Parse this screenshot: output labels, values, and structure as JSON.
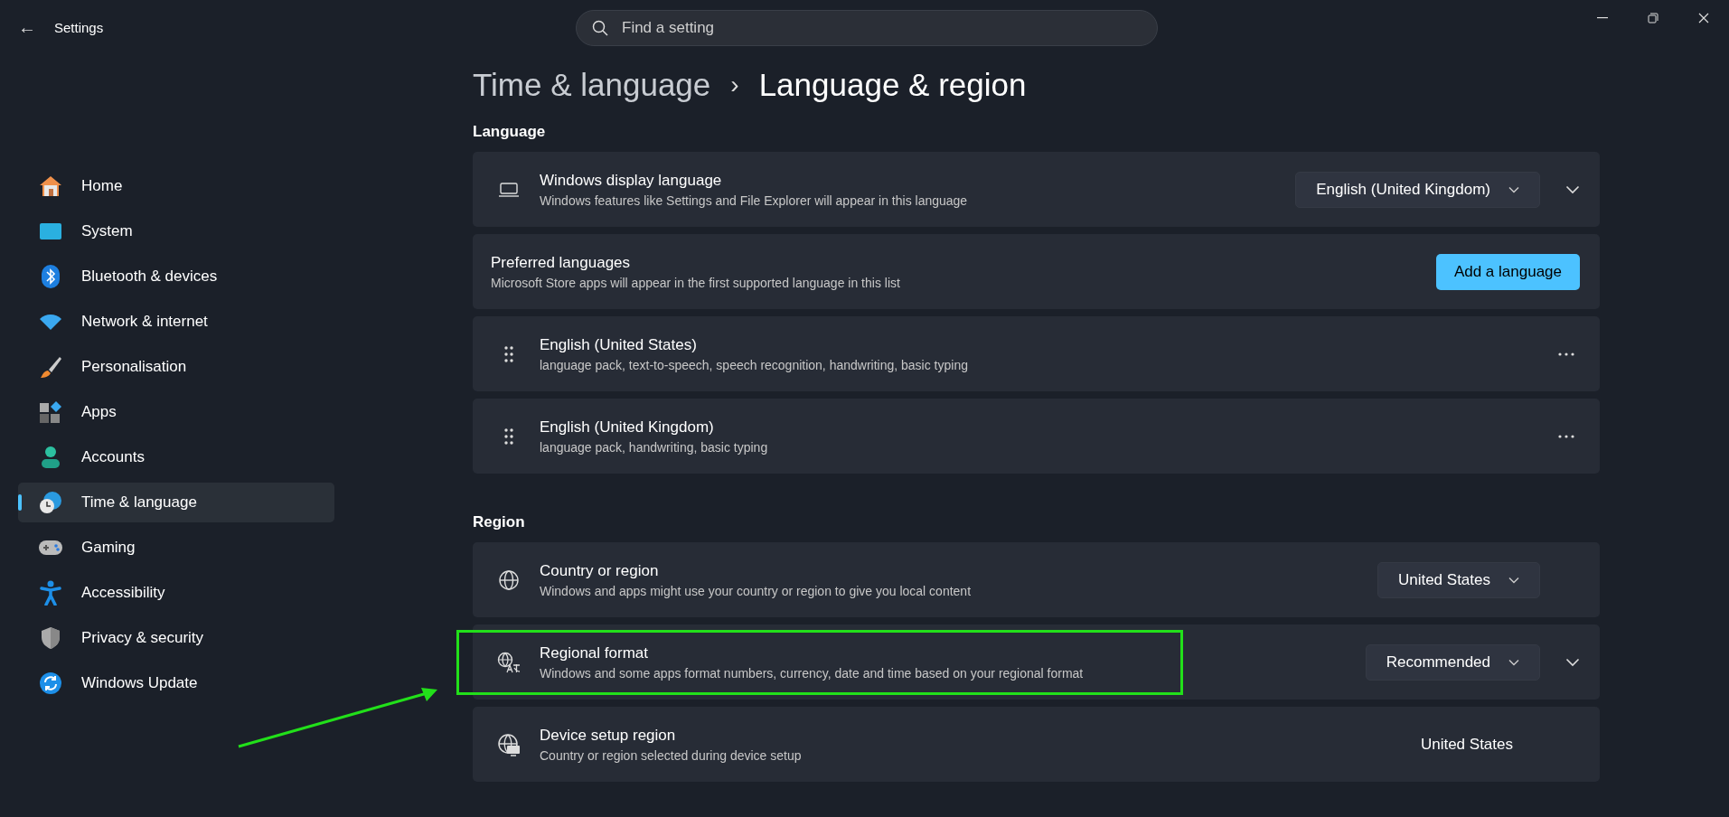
{
  "window": {
    "title": "Settings",
    "back": "←"
  },
  "search": {
    "placeholder": "Find a setting"
  },
  "sidebar": {
    "items": [
      {
        "label": "Home",
        "selected": false
      },
      {
        "label": "System",
        "selected": false
      },
      {
        "label": "Bluetooth & devices",
        "selected": false
      },
      {
        "label": "Network & internet",
        "selected": false
      },
      {
        "label": "Personalisation",
        "selected": false
      },
      {
        "label": "Apps",
        "selected": false
      },
      {
        "label": "Accounts",
        "selected": false
      },
      {
        "label": "Time & language",
        "selected": true
      },
      {
        "label": "Gaming",
        "selected": false
      },
      {
        "label": "Accessibility",
        "selected": false
      },
      {
        "label": "Privacy & security",
        "selected": false
      },
      {
        "label": "Windows Update",
        "selected": false
      }
    ]
  },
  "breadcrumb": {
    "parent": "Time & language",
    "separator": "›",
    "current": "Language & region"
  },
  "sections": [
    {
      "heading": "Language",
      "rows": [
        {
          "kind": "dropdown",
          "title": "Windows display language",
          "description": "Windows features like Settings and File Explorer will appear in this language",
          "value": "English (United Kingdom)",
          "expandable": true,
          "highlighted": false
        },
        {
          "kind": "button",
          "title": "Preferred languages",
          "description": "Microsoft Store apps will appear in the first supported language in this list",
          "button_label": "Add a language",
          "highlighted": false
        },
        {
          "kind": "language",
          "title": "English (United States)",
          "description": "language pack, text-to-speech, speech recognition, handwriting, basic typing",
          "highlighted": false
        },
        {
          "kind": "language",
          "title": "English (United Kingdom)",
          "description": "language pack, handwriting, basic typing",
          "highlighted": false
        }
      ]
    },
    {
      "heading": "Region",
      "rows": [
        {
          "kind": "dropdown",
          "title": "Country or region",
          "description": "Windows and apps might use your country or region to give you local content",
          "value": "United States",
          "expandable": false,
          "highlighted": false
        },
        {
          "kind": "dropdown",
          "title": "Regional format",
          "description": "Windows and some apps format numbers, currency, date and time based on your regional format",
          "value": "Recommended",
          "expandable": true,
          "highlighted": true
        },
        {
          "kind": "value",
          "title": "Device setup region",
          "description": "Country or region selected during device setup",
          "value": "United States",
          "highlighted": false
        }
      ]
    }
  ],
  "annotation": {
    "kind": "arrow"
  }
}
